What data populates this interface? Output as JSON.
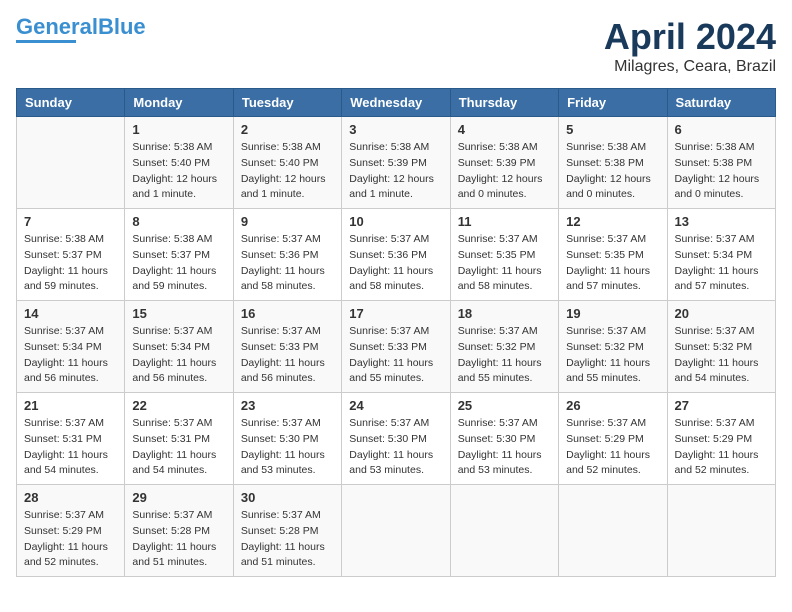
{
  "header": {
    "logo_line1": "General",
    "logo_line2": "Blue",
    "month_title": "April 2024",
    "location": "Milagres, Ceara, Brazil"
  },
  "weekdays": [
    "Sunday",
    "Monday",
    "Tuesday",
    "Wednesday",
    "Thursday",
    "Friday",
    "Saturday"
  ],
  "weeks": [
    [
      {
        "day": "",
        "info": ""
      },
      {
        "day": "1",
        "info": "Sunrise: 5:38 AM\nSunset: 5:40 PM\nDaylight: 12 hours\nand 1 minute."
      },
      {
        "day": "2",
        "info": "Sunrise: 5:38 AM\nSunset: 5:40 PM\nDaylight: 12 hours\nand 1 minute."
      },
      {
        "day": "3",
        "info": "Sunrise: 5:38 AM\nSunset: 5:39 PM\nDaylight: 12 hours\nand 1 minute."
      },
      {
        "day": "4",
        "info": "Sunrise: 5:38 AM\nSunset: 5:39 PM\nDaylight: 12 hours\nand 0 minutes."
      },
      {
        "day": "5",
        "info": "Sunrise: 5:38 AM\nSunset: 5:38 PM\nDaylight: 12 hours\nand 0 minutes."
      },
      {
        "day": "6",
        "info": "Sunrise: 5:38 AM\nSunset: 5:38 PM\nDaylight: 12 hours\nand 0 minutes."
      }
    ],
    [
      {
        "day": "7",
        "info": "Sunrise: 5:38 AM\nSunset: 5:37 PM\nDaylight: 11 hours\nand 59 minutes."
      },
      {
        "day": "8",
        "info": "Sunrise: 5:38 AM\nSunset: 5:37 PM\nDaylight: 11 hours\nand 59 minutes."
      },
      {
        "day": "9",
        "info": "Sunrise: 5:37 AM\nSunset: 5:36 PM\nDaylight: 11 hours\nand 58 minutes."
      },
      {
        "day": "10",
        "info": "Sunrise: 5:37 AM\nSunset: 5:36 PM\nDaylight: 11 hours\nand 58 minutes."
      },
      {
        "day": "11",
        "info": "Sunrise: 5:37 AM\nSunset: 5:35 PM\nDaylight: 11 hours\nand 58 minutes."
      },
      {
        "day": "12",
        "info": "Sunrise: 5:37 AM\nSunset: 5:35 PM\nDaylight: 11 hours\nand 57 minutes."
      },
      {
        "day": "13",
        "info": "Sunrise: 5:37 AM\nSunset: 5:34 PM\nDaylight: 11 hours\nand 57 minutes."
      }
    ],
    [
      {
        "day": "14",
        "info": "Sunrise: 5:37 AM\nSunset: 5:34 PM\nDaylight: 11 hours\nand 56 minutes."
      },
      {
        "day": "15",
        "info": "Sunrise: 5:37 AM\nSunset: 5:34 PM\nDaylight: 11 hours\nand 56 minutes."
      },
      {
        "day": "16",
        "info": "Sunrise: 5:37 AM\nSunset: 5:33 PM\nDaylight: 11 hours\nand 56 minutes."
      },
      {
        "day": "17",
        "info": "Sunrise: 5:37 AM\nSunset: 5:33 PM\nDaylight: 11 hours\nand 55 minutes."
      },
      {
        "day": "18",
        "info": "Sunrise: 5:37 AM\nSunset: 5:32 PM\nDaylight: 11 hours\nand 55 minutes."
      },
      {
        "day": "19",
        "info": "Sunrise: 5:37 AM\nSunset: 5:32 PM\nDaylight: 11 hours\nand 55 minutes."
      },
      {
        "day": "20",
        "info": "Sunrise: 5:37 AM\nSunset: 5:32 PM\nDaylight: 11 hours\nand 54 minutes."
      }
    ],
    [
      {
        "day": "21",
        "info": "Sunrise: 5:37 AM\nSunset: 5:31 PM\nDaylight: 11 hours\nand 54 minutes."
      },
      {
        "day": "22",
        "info": "Sunrise: 5:37 AM\nSunset: 5:31 PM\nDaylight: 11 hours\nand 54 minutes."
      },
      {
        "day": "23",
        "info": "Sunrise: 5:37 AM\nSunset: 5:30 PM\nDaylight: 11 hours\nand 53 minutes."
      },
      {
        "day": "24",
        "info": "Sunrise: 5:37 AM\nSunset: 5:30 PM\nDaylight: 11 hours\nand 53 minutes."
      },
      {
        "day": "25",
        "info": "Sunrise: 5:37 AM\nSunset: 5:30 PM\nDaylight: 11 hours\nand 53 minutes."
      },
      {
        "day": "26",
        "info": "Sunrise: 5:37 AM\nSunset: 5:29 PM\nDaylight: 11 hours\nand 52 minutes."
      },
      {
        "day": "27",
        "info": "Sunrise: 5:37 AM\nSunset: 5:29 PM\nDaylight: 11 hours\nand 52 minutes."
      }
    ],
    [
      {
        "day": "28",
        "info": "Sunrise: 5:37 AM\nSunset: 5:29 PM\nDaylight: 11 hours\nand 52 minutes."
      },
      {
        "day": "29",
        "info": "Sunrise: 5:37 AM\nSunset: 5:28 PM\nDaylight: 11 hours\nand 51 minutes."
      },
      {
        "day": "30",
        "info": "Sunrise: 5:37 AM\nSunset: 5:28 PM\nDaylight: 11 hours\nand 51 minutes."
      },
      {
        "day": "",
        "info": ""
      },
      {
        "day": "",
        "info": ""
      },
      {
        "day": "",
        "info": ""
      },
      {
        "day": "",
        "info": ""
      }
    ]
  ]
}
